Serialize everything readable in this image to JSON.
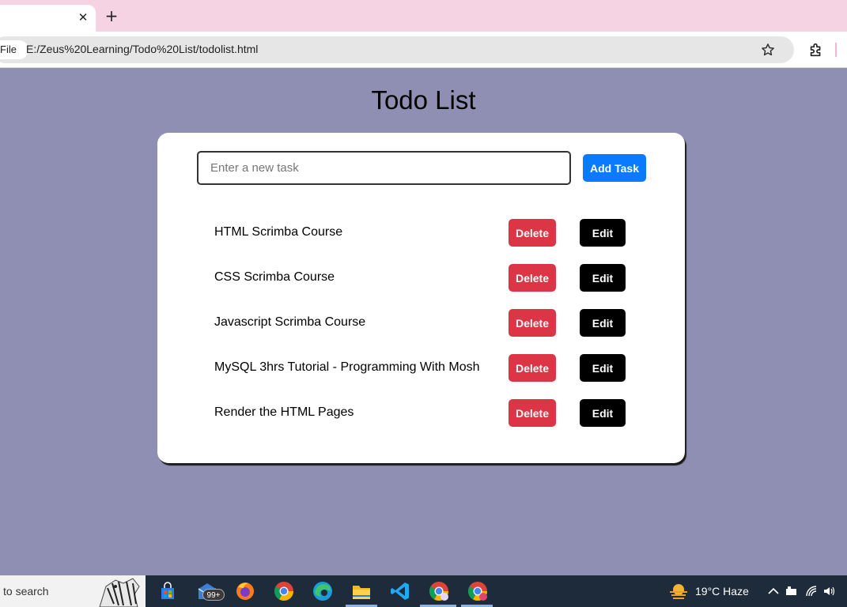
{
  "browser": {
    "tab_close_glyph": "✕",
    "new_tab_glyph": "+",
    "file_chip": "File",
    "url": "E:/Zeus%20Learning/Todo%20List/todolist.html",
    "icons": [
      "star-icon",
      "extensions-icon"
    ]
  },
  "page": {
    "title": "Todo List",
    "input_placeholder": "Enter a new task",
    "input_value": "",
    "add_button": "Add Task"
  },
  "tasks": [
    {
      "name": "HTML Scrimba Course",
      "delete": "Delete",
      "edit": "Edit"
    },
    {
      "name": "CSS Scrimba Course",
      "delete": "Delete",
      "edit": "Edit"
    },
    {
      "name": "Javascript Scrimba Course",
      "delete": "Delete",
      "edit": "Edit"
    },
    {
      "name": "MySQL 3hrs Tutorial - Programming With Mosh",
      "delete": "Delete",
      "edit": "Edit"
    },
    {
      "name": "Render the HTML Pages",
      "delete": "Delete",
      "edit": "Edit"
    }
  ],
  "colors": {
    "background": "#8f8fb3",
    "add_button": "#0a7bff",
    "delete_button": "#dc3545",
    "edit_button": "#000000",
    "tab_strip": "#f6d3e3"
  },
  "taskbar": {
    "search_text": "to search",
    "mail_badge": "99+",
    "weather": "19°C  Haze",
    "pinned_icons": [
      "store-icon",
      "mail-icon",
      "firefox-icon",
      "chrome-icon",
      "edge-icon",
      "file-explorer-icon",
      "vscode-icon",
      "chrome-profile-icon",
      "chrome-profile-k-icon"
    ],
    "tray_icons": [
      "chevron-up-icon",
      "battery-icon",
      "wifi-icon",
      "volume-icon"
    ]
  }
}
